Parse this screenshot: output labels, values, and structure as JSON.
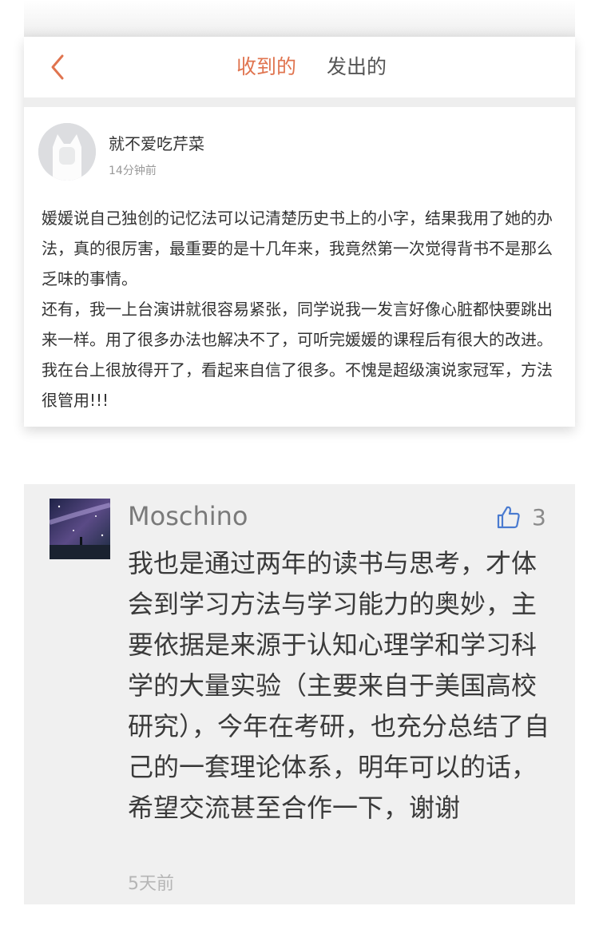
{
  "tabs": {
    "received": "收到的",
    "sent": "发出的"
  },
  "message": {
    "username": "就不爱吃芹菜",
    "time": "14分钟前",
    "paragraph1": "媛媛说自己独创的记忆法可以记清楚历史书上的小字，结果我用了她的办法，真的很厉害，最重要的是十几年来，我竟然第一次觉得背书不是那么乏味的事情。",
    "paragraph2": "还有，我一上台演讲就很容易紧张，同学说我一发言好像心脏都快要跳出来一样。用了很多办法也解决不了，可听完媛媛的课程后有很大的改进。我在台上很放得开了，看起来自信了很多。不愧是超级演说家冠军，方法很管用!!!"
  },
  "comment": {
    "username": "Moschino",
    "likes": "3",
    "text": "我也是通过两年的读书与思考，才体会到学习方法与学习能力的奥妙，主要依据是来源于认知心理学和学习科学的大量实验（主要来自于美国高校研究），今年在考研，也充分总结了自己的一套理论体系，明年可以的话，希望交流甚至合作一下，谢谢",
    "time": "5天前"
  },
  "icons": {
    "back": "chevron-left-icon",
    "like": "thumbs-up-icon"
  },
  "colors": {
    "accent": "#e0744f",
    "comment_bg": "#f0f0f0"
  }
}
